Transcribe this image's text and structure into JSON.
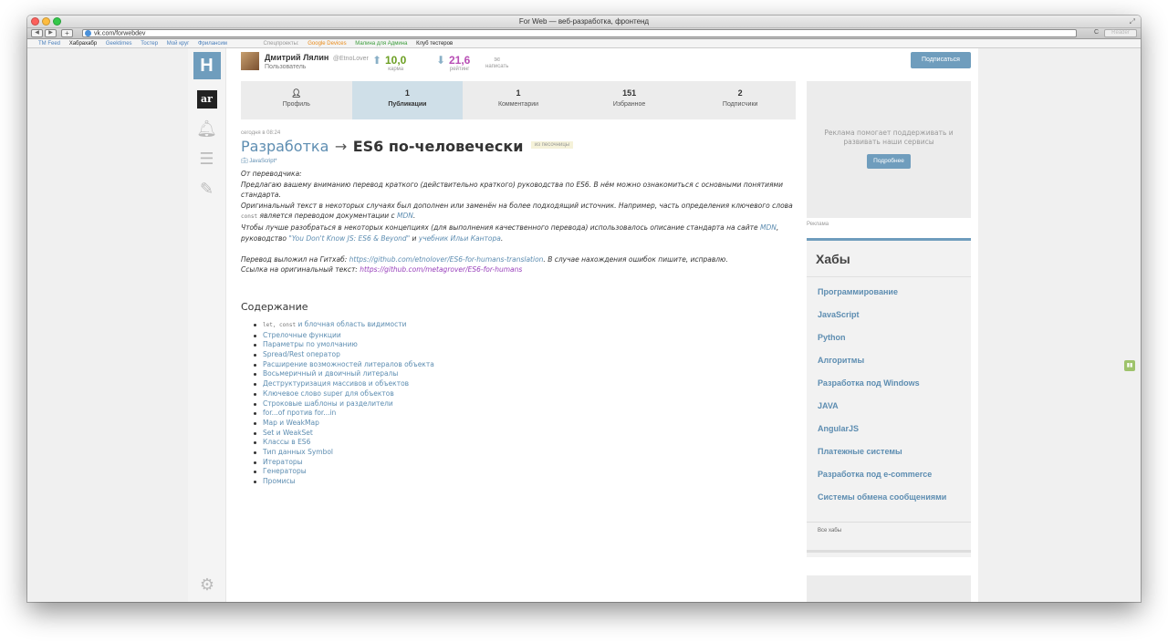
{
  "window": {
    "title": "For Web — веб-разработка, фронтенд"
  },
  "toolbar": {
    "url": "vk.com/forwebdev",
    "reader_label": "Reader",
    "plus_label": "+",
    "back_label": "◀",
    "fwd_label": "▶",
    "reload_label": "C"
  },
  "bookmarks": {
    "items": [
      "TM Feed",
      "Хабрахабр",
      "Geektimes",
      "Тостер",
      "Мой круг",
      "Фрилансим"
    ],
    "special_label": "Спецпроекты:",
    "special": [
      "Google Devices",
      "Малина для Админа",
      "Клуб тестеров"
    ]
  },
  "user": {
    "name": "Дмитрий Лялин",
    "nick": "@EtnoLover",
    "role": "Пользователь",
    "karma": "10,0",
    "karma_label": "карма",
    "rating": "21,6",
    "rating_label": "рейтинг",
    "message_label": "написать",
    "subscribe_label": "Подписаться"
  },
  "tabs": [
    {
      "num": "",
      "label": "Профиль"
    },
    {
      "num": "1",
      "label": "Публикации"
    },
    {
      "num": "1",
      "label": "Комментарии"
    },
    {
      "num": "151",
      "label": "Избранное"
    },
    {
      "num": "2",
      "label": "Подписчики"
    }
  ],
  "post": {
    "date": "сегодня в 08:24",
    "hub": "Разработка",
    "arrow": "→",
    "title": "ES6 по-человечески",
    "sandbox": "из песочницы",
    "tag": "JavaScript*",
    "p1": "От переводчика:",
    "p2": "Предлагаю вашему вниманию перевод краткого (действительно краткого) руководства по ES6. В нём можно ознакомиться с основными понятиями стандарта.",
    "p3_a": "Оригинальный текст в некоторых случаях был дополнен или заменён на более подходящий источник. Например, часть определения ключевого слова ",
    "p3_code": "const",
    "p3_b": " является переводом документации с ",
    "p3_link": "MDN",
    "p3_c": ".",
    "p4_a": "Чтобы лучше разобраться в некоторых концепциях (для выполнения качественного перевода) использовалось описание стандарта на сайте ",
    "p4_link1": "MDN",
    "p4_b": ", руководство ",
    "p4_link2": "\"You Don't Know JS: ES6 & Beyond\"",
    "p4_c": " и ",
    "p4_link3": "учебник Ильи Кантора",
    "p4_d": ".",
    "p5_a": "Перевод выложил на Гитхаб: ",
    "p5_link": "https://github.com/etnolover/ES6-for-humans-translation",
    "p5_b": ". В случае нахождения ошибок пишите, исправлю.",
    "p6_a": "Ссылка на оригинальный текст: ",
    "p6_link": "https://github.com/metagrover/ES6-for-humans",
    "toc_title": "Содержание",
    "toc_first_code": "let, const",
    "toc_first_rest": " и блочная область видимости",
    "toc": [
      "Стрелочные функции",
      "Параметры по умолчанию",
      "Spread/Rest оператор",
      "Расширение возможностей литералов объекта",
      "Восьмеричный и двоичный литералы",
      "Деструктуризация массивов и объектов",
      "Ключевое слово super для объектов",
      "Строковые шаблоны и разделители",
      "for...of против for...in",
      "Map и WeakMap",
      "Set и WeakSet",
      "Классы в ES6",
      "Тип данных Symbol",
      "Итераторы",
      "Генераторы",
      "Промисы"
    ]
  },
  "ad": {
    "text": "Реклама помогает поддерживать и развивать наши сервисы",
    "button": "Подробнее",
    "label": "Реклама"
  },
  "hubs": {
    "title": "Хабы",
    "items": [
      "Программирование",
      "JavaScript",
      "Python",
      "Алгоритмы",
      "Разработка под Windows",
      "JAVA",
      "AngularJS",
      "Платежные системы",
      "Разработка под e-commerce",
      "Системы обмена сообщениями"
    ],
    "all": "Все хабы"
  },
  "colors": {
    "accent": "#6f9dbd",
    "karma": "#6c9f23",
    "rating": "#b84fb5",
    "link": "#5d8db1"
  },
  "icons": [
    "profile-icon",
    "bell-icon",
    "menu-icon",
    "pen-icon",
    "gear-icon",
    "envelope-icon",
    "arrow-up-icon",
    "arrow-down-icon",
    "briefcase-icon",
    "globe-icon"
  ]
}
